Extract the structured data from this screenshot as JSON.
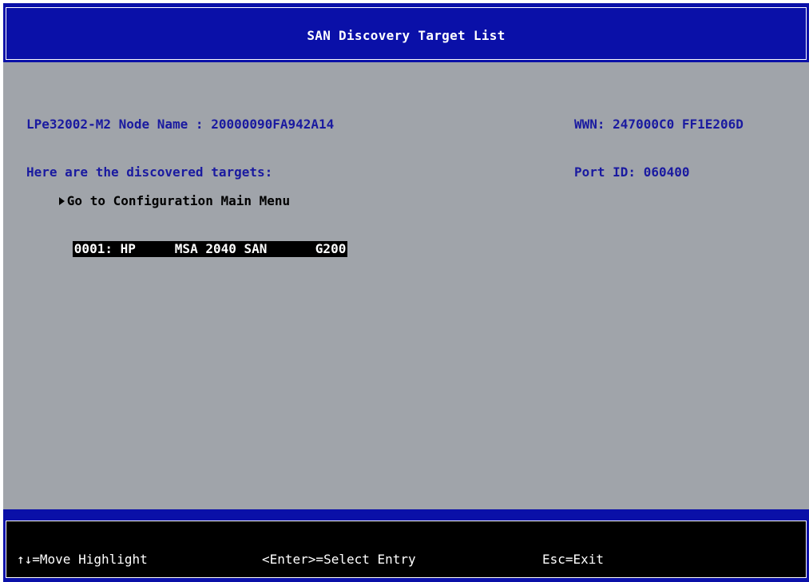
{
  "header": {
    "title": "SAN Discovery Target List"
  },
  "info": {
    "node_line": "LPe32002-M2 Node Name : 20000090FA942A14",
    "subtitle": "Here are the discovered targets:",
    "wwn": "WWN: 247000C0 FF1E206D",
    "port_id": "Port ID: 060400"
  },
  "menu": {
    "main_menu_label": "Go to Configuration Main Menu",
    "targets": [
      {
        "id": "0001: HP",
        "model": "MSA 2040 SAN",
        "revision": "G200"
      }
    ]
  },
  "footer": {
    "move_help": "↑↓=Move Highlight",
    "enter_help": "<Enter>=Select Entry",
    "esc_help": "Esc=Exit"
  },
  "colors": {
    "header_bg": "#0a10a8",
    "body_bg": "#a0a4aa",
    "info_text": "#1a1aa0",
    "highlight_bg": "#000000",
    "highlight_text": "#ffffff"
  }
}
